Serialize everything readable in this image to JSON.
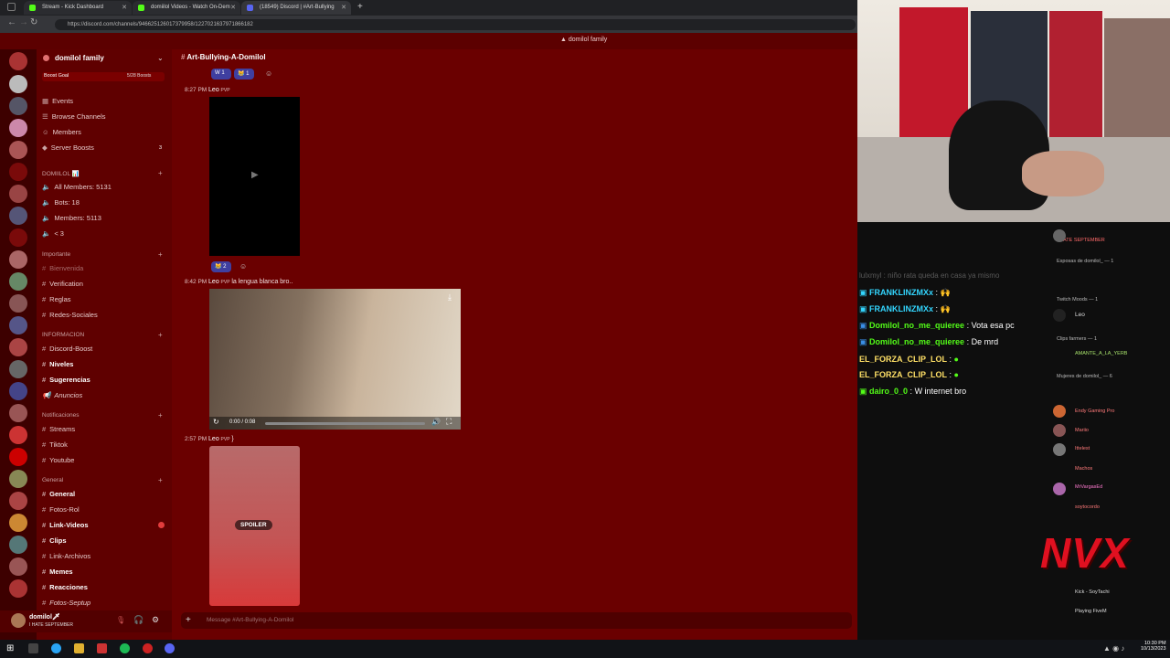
{
  "browser": {
    "tabs": [
      {
        "label": "Stream - Kick Dashboard",
        "fav": "#53fc18"
      },
      {
        "label": "domiilol Videos - Watch On-Dem",
        "fav": "#53fc18"
      },
      {
        "label": "(18549) Discord | #Art-Bullying",
        "fav": "#5865f2"
      }
    ],
    "url": "https://discord.com/channels/946625126017379958/1227021637971866182"
  },
  "discord": {
    "top_title": "domilol family",
    "server_name": "domilol family",
    "boost_goal": "Boost Goal",
    "boost_count": "5/28 Boosts",
    "nav": [
      "Events",
      "Browse Channels",
      "Members",
      "Server Boosts"
    ],
    "server_boosts_badge": "3",
    "stats_category": "DOMIILOL 📊",
    "stats": [
      "All Members: 5131",
      "Bots: 18",
      "Members: 5113",
      "< 3"
    ],
    "cat_importante": "Importante",
    "importante": [
      "Bienvenida",
      "Verification",
      "Reglas",
      "Redes-Sociales"
    ],
    "cat_informacion": "INFORMACION",
    "informacion": [
      "Discord-Boost",
      "Niveles",
      "Sugerencias",
      "Anuncios"
    ],
    "cat_notificaciones": "Notificaciones",
    "notificaciones": [
      "Streams",
      "Tiktok",
      "Youtube"
    ],
    "cat_general": "General",
    "general": [
      "General",
      "Fotos-Rol",
      "Link-Videos",
      "Clips",
      "Link-Archivos",
      "Memes",
      "Reacciones",
      "Fotos-Septup"
    ],
    "user_name": "domilol🗡",
    "user_status": "I HATE SEPTEMBER",
    "channel_title": "Art-Bullying-A-Domilol",
    "msg1_time": "8:27 PM",
    "msg1_author": "Leo",
    "msg1_tag": "PVP",
    "reactions_top": [
      "1",
      "1"
    ],
    "reactions_mid": [
      "2"
    ],
    "msg2_time": "8:42 PM",
    "msg2_author": "Leo",
    "msg2_tag": "PVP",
    "msg2_text": "la lengua blanca bro..",
    "video_time": "0:00 / 0:08",
    "msg3_time": "2:57 PM",
    "msg3_author": "Leo",
    "msg3_tag": "PVP",
    "msg3_text": "}",
    "spoiler": "SPOILER",
    "input_placeholder": "Message #Art-Bullying-A-Domilol"
  },
  "stream_chat": {
    "lines": [
      {
        "user": "FRANKLINZMXx",
        "text": "🙌",
        "color": "#33d6ff"
      },
      {
        "user": "FRANKLINZMXx",
        "text": "🙌",
        "color": "#33d6ff"
      },
      {
        "user": "Domilol_no_me_quieree",
        "text": "Vota esa pc",
        "color": "#53fc18"
      },
      {
        "user": "Domilol_no_me_quieree",
        "text": "De mrd",
        "color": "#53fc18"
      },
      {
        "user": "EL_FORZA_CLIP_LOL",
        "text": "",
        "color": "#ffe066"
      },
      {
        "user": "EL_FORZA_CLIP_LOL",
        "text": "",
        "color": "#ffe066"
      },
      {
        "user": "dairo_0_0",
        "text": "W internet bro",
        "color": "#53fc18"
      }
    ],
    "faded_line": "lulxmyl : niño rata queda en casa ya mismo"
  },
  "members_overlay": {
    "items": [
      "I HATE SEPTEMBER",
      "Esposas de domilol_ — 1",
      "Twitch Moods — 1",
      "Leo",
      "Clips farmers — 1",
      "AMANTE_A_LA_YERB",
      "Mujeres de domilol_ — 6",
      "Endy Gaming Pro",
      "Mariio",
      "Ittelest",
      "Machos",
      "MrVargasEd",
      "soytocordo",
      "Kick - SoyTachi",
      "Playing FiveM"
    ]
  },
  "watermark": "NVX",
  "taskbar": {
    "time": "10:30 PM",
    "date": "10/13/2023"
  }
}
